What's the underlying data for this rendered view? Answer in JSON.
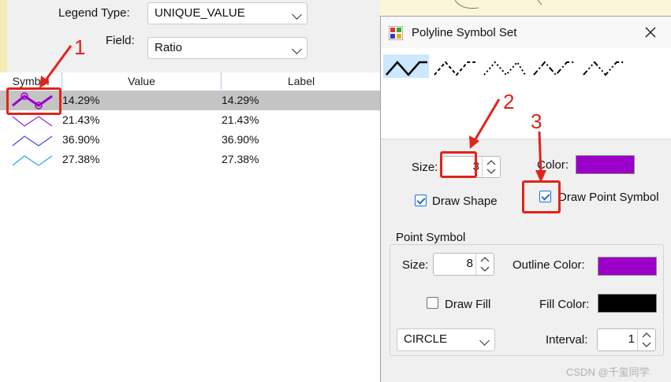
{
  "legend": {
    "legend_type_label": "Legend Type:",
    "legend_type_value": "UNIQUE_VALUE",
    "field_label": "Field:",
    "field_value": "Ratio"
  },
  "table": {
    "columns": [
      "Symbol",
      "Value",
      "Label"
    ],
    "rows": [
      {
        "value": "14.29%",
        "label": "14.29%",
        "color": "#9a00c8",
        "selected": true
      },
      {
        "value": "21.43%",
        "label": "21.43%",
        "color": "#9a2ad8"
      },
      {
        "value": "36.90%",
        "label": "36.90%",
        "color": "#4a4ae6"
      },
      {
        "value": "27.38%",
        "label": "27.38%",
        "color": "#2aa7f0"
      }
    ]
  },
  "dialog": {
    "title": "Polyline Symbol Set",
    "app_icon": "polyline-app-icon",
    "close_icon": "close-icon",
    "line_styles": [
      "solid",
      "dash",
      "dot",
      "dash-dot",
      "dash-dot-dot"
    ],
    "size_label": "Size:",
    "size_value": "3",
    "color_label": "Color:",
    "line_color": "#9a00c8",
    "draw_shape_label": "Draw Shape",
    "draw_shape_checked": true,
    "draw_point_label": "Draw Point Symbol",
    "draw_point_checked": true,
    "point_group_label": "Point Symbol",
    "point_size_label": "Size:",
    "point_size_value": "8",
    "outline_color_label": "Outline Color:",
    "outline_color": "#9a00c8",
    "draw_fill_label": "Draw Fill",
    "draw_fill_checked": false,
    "fill_color_label": "Fill Color:",
    "fill_color": "#000000",
    "shape_value": "CIRCLE",
    "interval_label": "Interval:",
    "interval_value": "1"
  },
  "annotations": {
    "n1": "1",
    "n2": "2",
    "n3": "3",
    "accent": "#e0241b"
  },
  "watermark": "CSDN @千玺同学"
}
